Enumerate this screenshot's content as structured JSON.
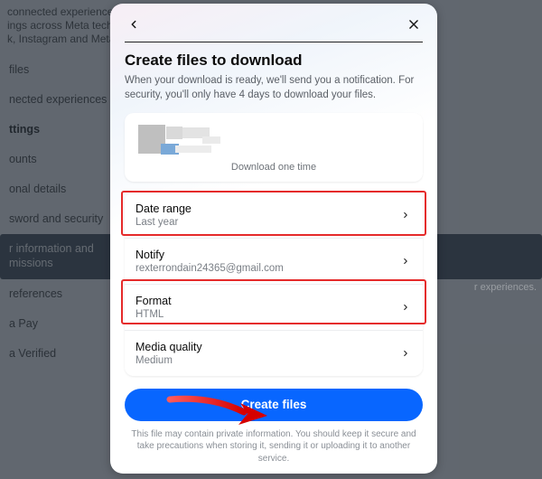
{
  "background": {
    "intro": "connected experiences and\nings across Meta technol\nk, Instagram and Meta H",
    "items": [
      {
        "label": "files",
        "type": "item"
      },
      {
        "label": "nected experiences",
        "type": "item"
      },
      {
        "label": "ttings",
        "type": "heading"
      },
      {
        "label": "ounts",
        "type": "item"
      },
      {
        "label": "onal details",
        "type": "item"
      },
      {
        "label": "sword and security",
        "type": "item"
      },
      {
        "label": "r information and\nmissions",
        "type": "active"
      },
      {
        "label": "references",
        "type": "item"
      },
      {
        "label": "a Pay",
        "type": "item"
      },
      {
        "label": "a Verified",
        "type": "item"
      }
    ],
    "far_right_hint": "r experiences."
  },
  "modal": {
    "title": "Create files to download",
    "subtitle": "When your download is ready, we'll send you a notification. For security, you'll only have 4 days to download your files.",
    "info_caption": "Download one time",
    "rows": [
      {
        "label": "Date range",
        "value": "Last year"
      },
      {
        "label": "Notify",
        "value": "rexterrondain24365@gmail.com"
      },
      {
        "label": "Format",
        "value": "HTML"
      },
      {
        "label": "Media quality",
        "value": "Medium"
      }
    ],
    "primary_button": "Create files",
    "disclaimer": "This file may contain private information. You should keep it secure and take precautions when storing it, sending it or uploading it to another service."
  }
}
